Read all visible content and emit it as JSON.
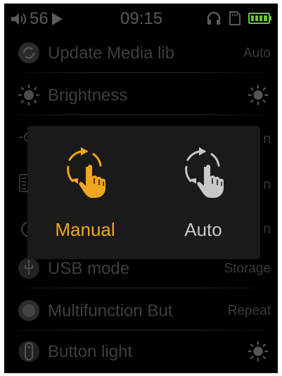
{
  "status_bar": {
    "volume": "56",
    "time": "09:15",
    "icons": [
      "speaker-icon",
      "play-icon",
      "headphones-icon",
      "sd-card-icon",
      "battery-icon"
    ]
  },
  "menu": {
    "items": [
      {
        "label": "Update Media lib",
        "value": "Auto",
        "icon": "refresh-icon"
      },
      {
        "label": "Brightness",
        "value": "",
        "icon": "sun-icon"
      },
      {
        "label": "",
        "value": "n",
        "icon": "sun-icon"
      },
      {
        "label": "",
        "value": "n",
        "icon": "grid-icon"
      },
      {
        "label": "",
        "value": "n",
        "icon": "power-icon"
      },
      {
        "label": "USB mode",
        "value": "Storage",
        "icon": "usb-icon"
      },
      {
        "label": "Multifunction But",
        "value": "Repeat",
        "icon": "circle-button-icon"
      },
      {
        "label": "Button light",
        "value": "",
        "icon": "button-icon"
      }
    ]
  },
  "popup": {
    "options": [
      {
        "label": "Manual",
        "icon": "manual-refresh-hand-icon",
        "selected": true
      },
      {
        "label": "Auto",
        "icon": "auto-refresh-hand-icon",
        "selected": false
      }
    ]
  },
  "colors": {
    "accent": "#f2a61d",
    "inactive": "#c8c8c8",
    "background": "#000000",
    "popup": "#1a1a1a"
  }
}
